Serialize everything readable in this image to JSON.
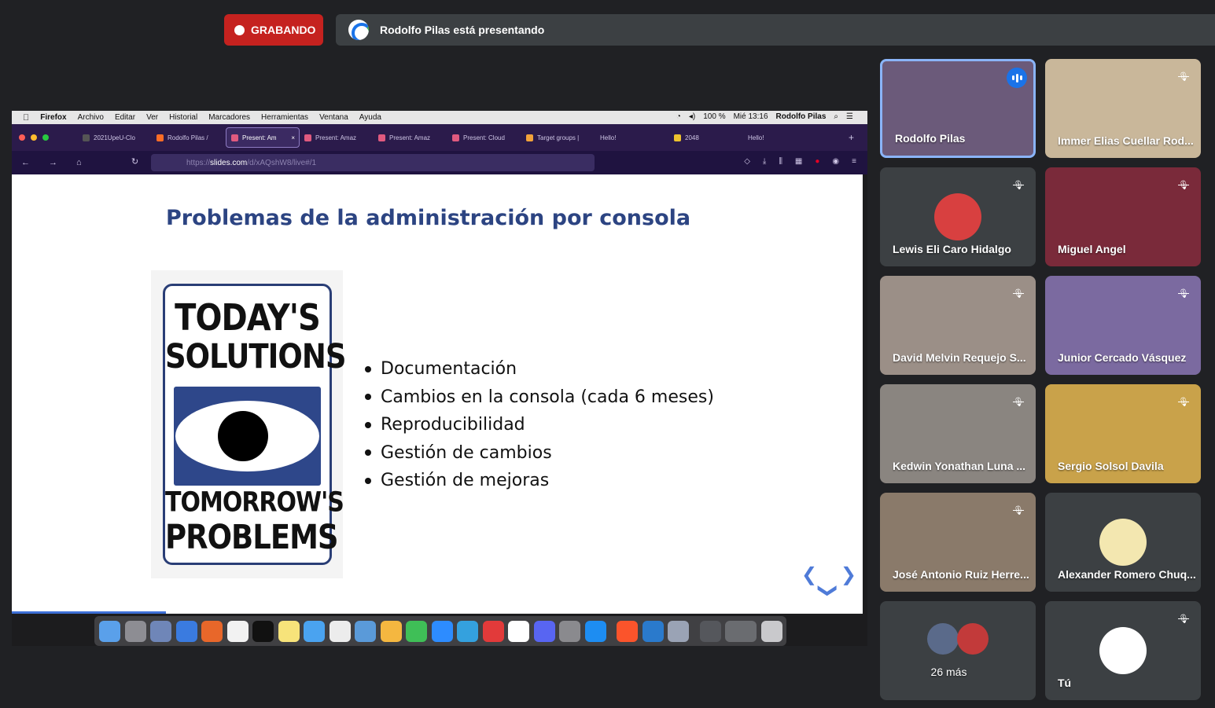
{
  "top": {
    "recording_label": "GRABANDO",
    "presenting_label": "Rodolfo Pilas está presentando"
  },
  "mac_menu": {
    "items": [
      "Firefox",
      "Archivo",
      "Editar",
      "Ver",
      "Historial",
      "Marcadores",
      "Herramientas",
      "Ventana",
      "Ayuda"
    ],
    "battery": "100 %",
    "clock": "Mié 13:16",
    "user": "Rodolfo Pilas"
  },
  "browser": {
    "tabs": [
      {
        "label": "2021UpeU-Clo",
        "fav_color": "#555555"
      },
      {
        "label": "Rodolfo Pilas /",
        "fav_color": "#fc6d26"
      },
      {
        "label": "Present: Am",
        "fav_color": "#e05a7f",
        "active": true
      },
      {
        "label": "Present: Amaz",
        "fav_color": "#e05a7f"
      },
      {
        "label": "Present: Amaz",
        "fav_color": "#e05a7f"
      },
      {
        "label": "Present: Cloud",
        "fav_color": "#e05a7f"
      },
      {
        "label": "Target groups |",
        "fav_color": "#f2a33a"
      },
      {
        "label": "Hello!",
        "fav_color": ""
      },
      {
        "label": "2048",
        "fav_color": "#edc22e"
      },
      {
        "label": "Hello!",
        "fav_color": ""
      }
    ],
    "url_prefix": "https://",
    "url_domain": "slides.com",
    "url_path": "/d/xAQshW8/live#/1"
  },
  "slide": {
    "title": "Problemas de la administración por consola",
    "poster_lines": [
      "TODAY'S",
      "SOLUTIONS",
      "TOMORROW'S",
      "PROBLEMS"
    ],
    "bullets": [
      "Documentación",
      "Cambios en la consola (cada 6 meses)",
      "Reproducibilidad",
      "Gestión de cambios",
      "Gestión de mejoras"
    ]
  },
  "participants": [
    {
      "name": "Rodolfo Pilas",
      "speaking": true,
      "bg": "#6b5a7a"
    },
    {
      "name": "Immer Elias Cuellar Rod...",
      "muted": true,
      "bg": "#c9b79a"
    },
    {
      "name": "Lewis Eli Caro Hidalgo",
      "muted": true,
      "bg": "#3c4043",
      "avatar": "#d84040"
    },
    {
      "name": "Miguel Angel",
      "muted": true,
      "bg": "#7a2a3a"
    },
    {
      "name": "David Melvin Requejo S...",
      "muted": true,
      "bg": "#9b8f87"
    },
    {
      "name": "Junior Cercado Vásquez",
      "muted": true,
      "bg": "#7b6aa0"
    },
    {
      "name": "Kedwin Yonathan Luna ...",
      "muted": true,
      "bg": "#8a8580"
    },
    {
      "name": "Sergio Solsol Davila",
      "muted": true,
      "bg": "#c9a24a"
    },
    {
      "name": "José Antonio Ruiz Herre...",
      "muted": true,
      "bg": "#8a7a6a"
    },
    {
      "name": "Alexander Romero Chuq...",
      "muted": false,
      "bg": "#3c4043",
      "avatar": "#f3e7b0"
    },
    {
      "name": "26 más",
      "bg": "#3c4043"
    },
    {
      "name": "Tú",
      "muted": true,
      "bg": "#3c4043",
      "avatar": "#ffffff"
    }
  ],
  "colors": {
    "accent": "#1a73e8",
    "record": "#c5221f",
    "slide_title": "#2c4482"
  },
  "icons": {
    "muted": "mic-off-icon",
    "speaking": "audio-level-icon"
  }
}
